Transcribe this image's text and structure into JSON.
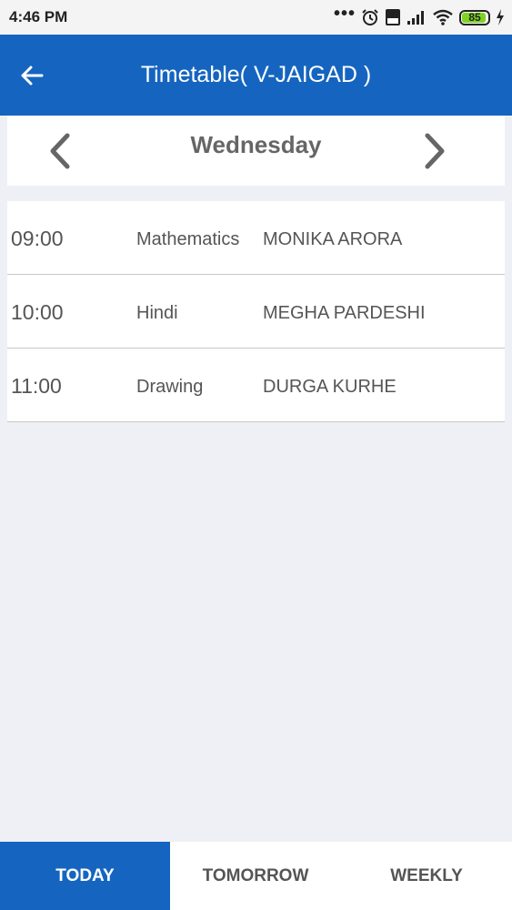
{
  "status_bar": {
    "time": "4:46 PM",
    "dots": "•••",
    "battery_level": "85"
  },
  "app_bar": {
    "title": "Timetable( V-JAIGAD )"
  },
  "day_selector": {
    "day": "Wednesday"
  },
  "timetable": {
    "rows": [
      {
        "time": "09:00",
        "subject": "Mathematics",
        "teacher": "MONIKA ARORA"
      },
      {
        "time": "10:00",
        "subject": "Hindi",
        "teacher": "MEGHA PARDESHI"
      },
      {
        "time": "11:00",
        "subject": "Drawing",
        "teacher": "DURGA KURHE"
      }
    ]
  },
  "tabs": {
    "today": "TODAY",
    "tomorrow": "TOMORROW",
    "weekly": "WEEKLY",
    "active": "today"
  },
  "colors": {
    "primary": "#1565c0",
    "background": "#eff0f5",
    "text": "#555555",
    "battery": "#7ed321"
  }
}
